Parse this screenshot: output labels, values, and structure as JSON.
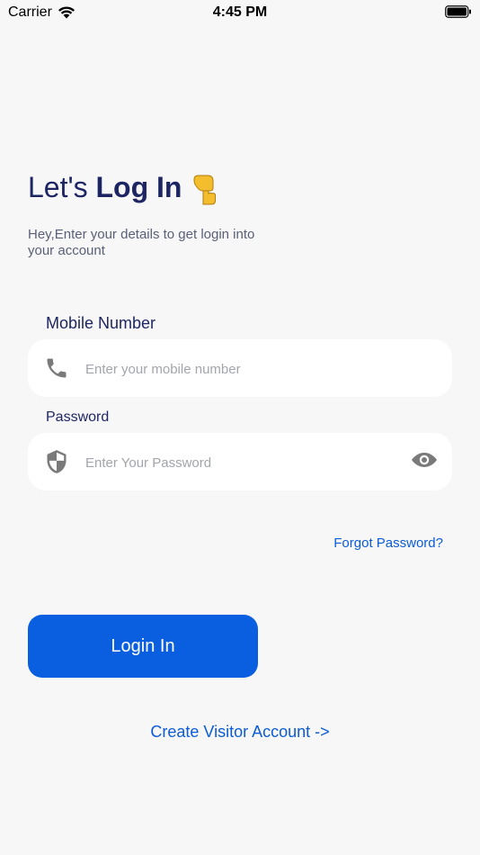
{
  "status_bar": {
    "carrier": "Carrier",
    "time": "4:45 PM"
  },
  "header": {
    "title_prefix": "Let's ",
    "title_bold": "Log In",
    "subtitle": "Hey,Enter your details to get login into your account"
  },
  "form": {
    "mobile_label": "Mobile Number",
    "mobile_placeholder": "Enter your mobile number",
    "password_label": "Password",
    "password_placeholder": "Enter Your Password",
    "forgot_label": "Forgot Password?"
  },
  "actions": {
    "login_label": "Login In",
    "visitor_label": "Create Visitor Account ->"
  },
  "icons": {
    "phone": "phone-icon",
    "shield": "shield-icon",
    "eye": "eye-icon",
    "hand": "pointing-hand-icon"
  },
  "colors": {
    "primary": "#0a5ee0",
    "link": "#0b5cd6",
    "heading": "#1d2663",
    "background": "#f7f7f7"
  }
}
